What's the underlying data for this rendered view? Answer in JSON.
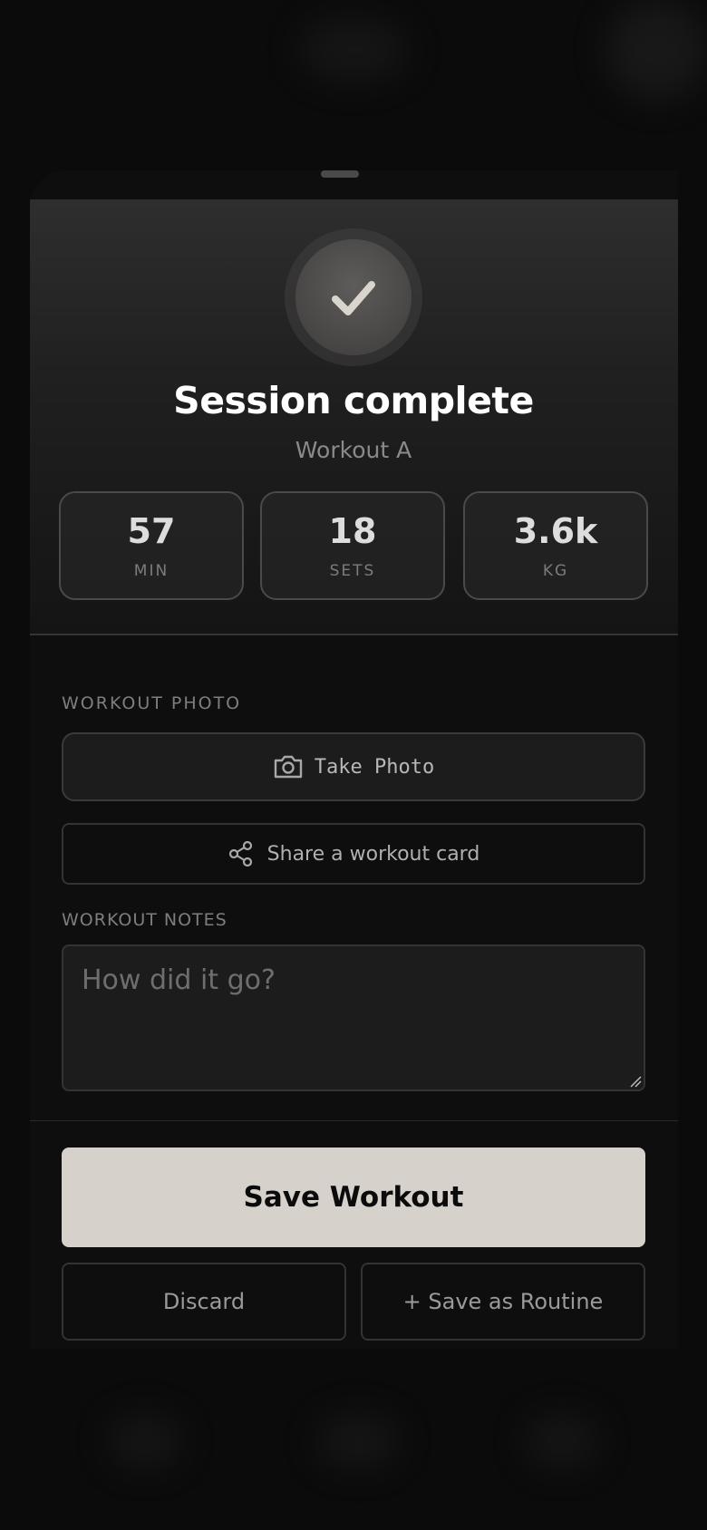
{
  "header": {
    "title": "Session complete",
    "subtitle": "Workout A"
  },
  "stats": [
    {
      "value": "57",
      "label": "MIN"
    },
    {
      "value": "18",
      "label": "SETS"
    },
    {
      "value": "3.6k",
      "label": "KG"
    }
  ],
  "photo": {
    "section_label": "WORKOUT PHOTO",
    "take_photo_label": "Take Photo",
    "share_label": "Share a workout card"
  },
  "notes": {
    "section_label": "WORKOUT NOTES",
    "placeholder": "How did it go?"
  },
  "actions": {
    "save_label": "Save Workout",
    "discard_label": "Discard",
    "save_routine_label": "+ Save as Routine"
  },
  "colors": {
    "background": "#0b0b0b",
    "primary_button": "#d6d1cb",
    "text_primary": "#ffffff",
    "text_muted": "#7e7e7e"
  },
  "icons": {
    "check": "check-icon",
    "camera": "camera-icon",
    "share": "share-icon"
  }
}
